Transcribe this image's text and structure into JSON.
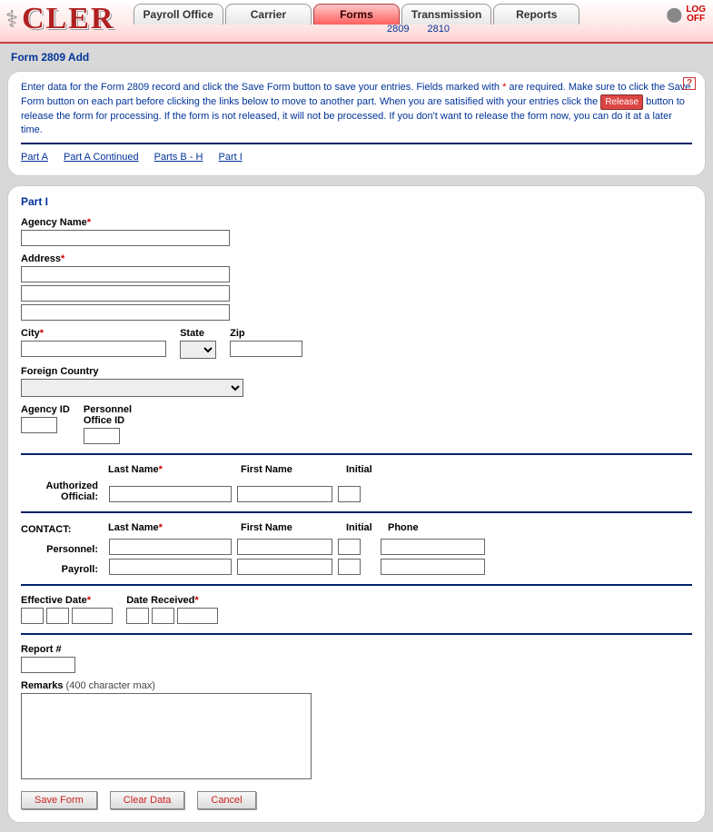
{
  "header": {
    "logo": "CLER",
    "tabs": [
      "Payroll Office",
      "Carrier",
      "Forms",
      "Transmission",
      "Reports"
    ],
    "activeTab": 2,
    "subtabs": [
      "2809",
      "2810"
    ],
    "logoff": "LOG OFF"
  },
  "pageTitle": "Form 2809 Add",
  "instructions": {
    "line1a": "Enter data for the Form 2809 record and click the Save Form button to save your entries.  Fields marked with ",
    "star": "*",
    "line1b": " are required.  Make sure to click the Save Form button on each part before clicking the links below to move to another part.  When you are satisified with your entries click the ",
    "releaseChip": "Release",
    "line1c": " button to release the form for processing.  If the form is not released, it will not be processed.  If you don't want to release the form now, you can do it at a later time."
  },
  "partLinks": [
    "Part A",
    "Part A Continued",
    "Parts B - H",
    "Part I"
  ],
  "form": {
    "sectionTitle": "Part I",
    "labels": {
      "agencyName": "Agency Name",
      "address": "Address",
      "city": "City",
      "state": "State",
      "zip": "Zip",
      "foreignCountry": "Foreign Country",
      "agencyId": "Agency ID",
      "personnelOfficeId": "Personnel Office ID",
      "authorizedOfficial": "Authorized Official:",
      "lastName": "Last Name",
      "firstName": "First Name",
      "initial": "Initial",
      "contact": "CONTACT:",
      "personnel": "Personnel:",
      "payroll": "Payroll:",
      "phone": "Phone",
      "effectiveDate": "Effective Date",
      "dateReceived": "Date Received",
      "reportNum": "Report #",
      "remarks": "Remarks",
      "remarksNote": "(400 character max)"
    },
    "values": {
      "agencyName": "",
      "address1": "",
      "address2": "",
      "address3": "",
      "city": "",
      "state": "",
      "zip": "",
      "foreignCountry": "",
      "agencyId": "",
      "personnelOfficeId": "",
      "aoLast": "",
      "aoFirst": "",
      "aoInit": "",
      "pLast": "",
      "pFirst": "",
      "pInit": "",
      "pPhone": "",
      "prLast": "",
      "prFirst": "",
      "prInit": "",
      "prPhone": "",
      "effM": "",
      "effD": "",
      "effY": "",
      "rcvM": "",
      "rcvD": "",
      "rcvY": "",
      "reportNum": "",
      "remarks": ""
    }
  },
  "buttons": {
    "save": "Save Form",
    "clear": "Clear Data",
    "cancel": "Cancel"
  }
}
